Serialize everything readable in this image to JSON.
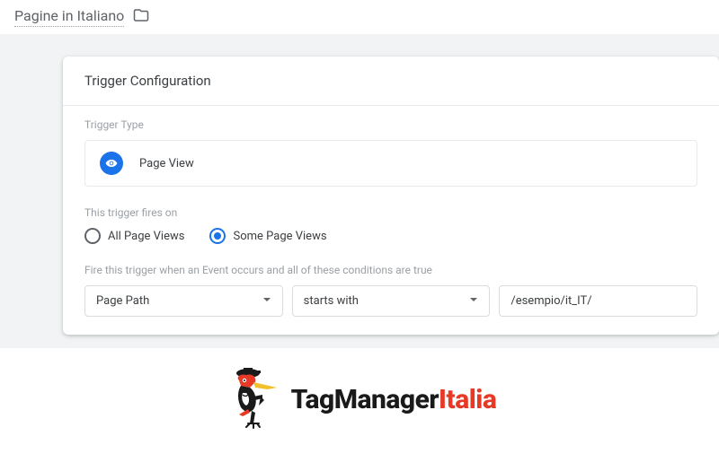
{
  "header": {
    "title": "Pagine in Italiano"
  },
  "card": {
    "heading": "Trigger Configuration",
    "type_label": "Trigger Type",
    "type_name": "Page View",
    "fires_label": "This trigger fires on",
    "radio_all": "All Page Views",
    "radio_some": "Some Page Views",
    "condition_label": "Fire this trigger when an Event occurs and all of these conditions are true",
    "cond_field": "Page Path",
    "cond_op": "starts with",
    "cond_value": "/esempio/it_IT/"
  },
  "logo": {
    "part1": "TagManager",
    "part2": "Italia"
  }
}
